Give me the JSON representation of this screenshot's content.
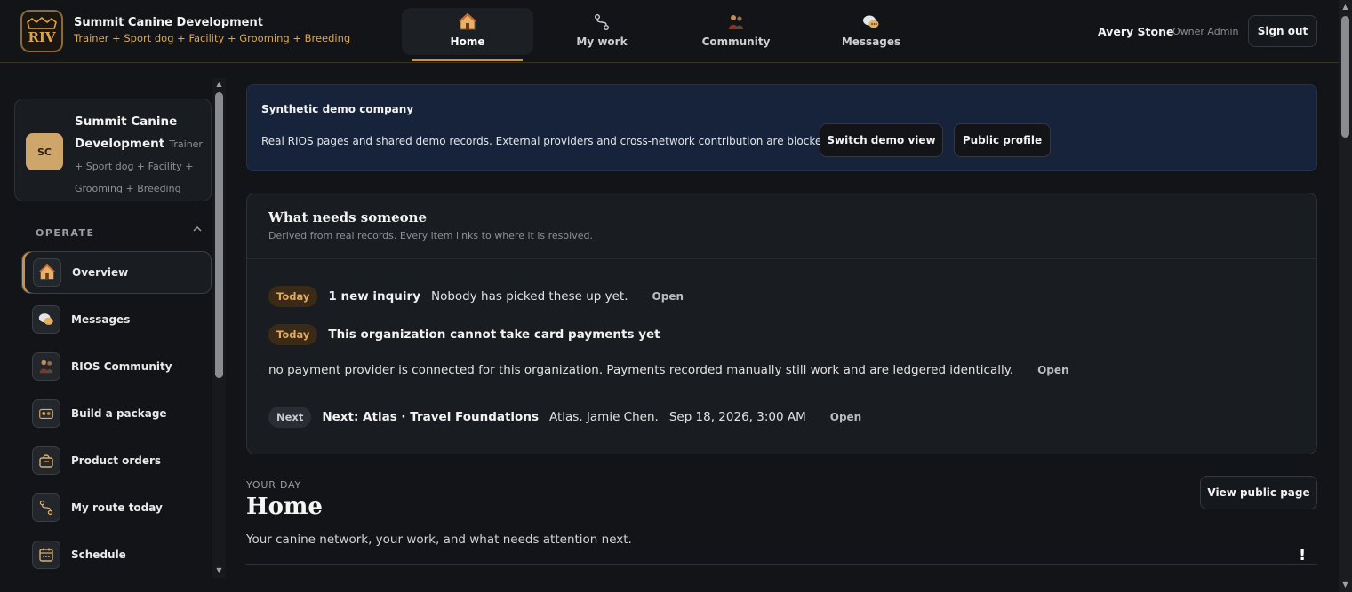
{
  "brand": {
    "logo_text": "RIOS",
    "name": "Summit Canine Development",
    "tagline": "Trainer + Sport dog + Facility + Grooming + Breeding"
  },
  "topnav": [
    {
      "label": "Home",
      "icon": "home-icon",
      "active": true
    },
    {
      "label": "My work",
      "icon": "route-icon",
      "active": false
    },
    {
      "label": "Community",
      "icon": "community-icon",
      "active": false
    },
    {
      "label": "Messages",
      "icon": "messages-icon",
      "active": false
    }
  ],
  "user": {
    "name": "Avery Stone",
    "role": "Owner Admin",
    "signout_label": "Sign out"
  },
  "sidebar": {
    "org": {
      "initials": "SC",
      "name": "Summit Canine Development",
      "tags": "Trainer + Sport dog + Facility + Grooming + Breeding"
    },
    "section": "OPERATE",
    "items": [
      {
        "label": "Overview",
        "icon": "home-icon",
        "active": true
      },
      {
        "label": "Messages",
        "icon": "messages-icon",
        "active": false
      },
      {
        "label": "RIOS Community",
        "icon": "community-icon",
        "active": false
      },
      {
        "label": "Build a package",
        "icon": "package-icon",
        "active": false
      },
      {
        "label": "Product orders",
        "icon": "basket-icon",
        "active": false
      },
      {
        "label": "My route today",
        "icon": "route-icon",
        "active": false
      },
      {
        "label": "Schedule",
        "icon": "calendar-icon",
        "active": false
      }
    ]
  },
  "banner": {
    "title": "Synthetic demo company",
    "text": "Real RIOS pages and shared demo records. External providers and cross-network contribution are blocked.",
    "switch_label": "Switch demo view",
    "public_label": "Public profile"
  },
  "needs": {
    "title": "What needs someone",
    "subtitle": "Derived from real records. Every item links to where it is resolved.",
    "items": [
      {
        "badge": "Today",
        "title": "1 new inquiry",
        "text": "Nobody has picked these up yet.",
        "link": "Open"
      },
      {
        "badge": "Today",
        "title": "This organization cannot take card payments yet"
      },
      {
        "text": "no payment provider is connected for this organization. Payments recorded manually still work and are ledgered identically.",
        "link": "Open"
      },
      {
        "badge": "Next",
        "title": "Next: Atlas · Travel Foundations",
        "text": "Atlas. Jamie Chen.",
        "time": "Sep 18, 2026, 3:00 AM",
        "link": "Open"
      }
    ]
  },
  "page": {
    "eyebrow": "YOUR DAY",
    "title": "Home",
    "subtitle": "Your canine network, your work, and what needs attention next.",
    "view_public_label": "View public page",
    "alert_mark": "!"
  },
  "colors": {
    "accent": "#c9924a",
    "banner_bg": "#16233b",
    "today_badge": "#3a2a16",
    "background": "#121417"
  }
}
